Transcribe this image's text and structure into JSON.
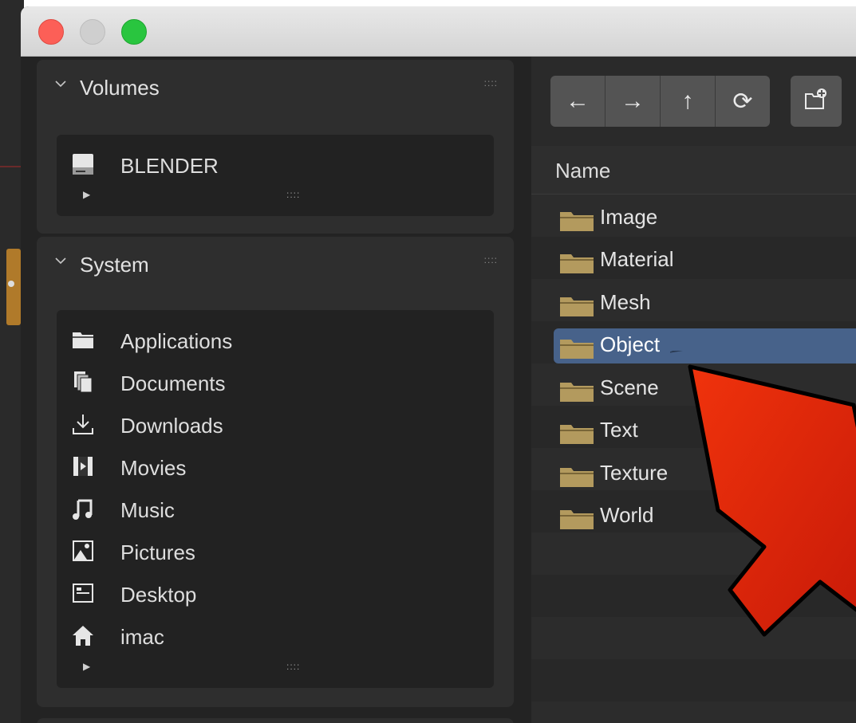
{
  "sidebar": {
    "volumes": {
      "title": "Volumes",
      "items": [
        {
          "label": "BLENDER",
          "icon": "drive-icon"
        }
      ]
    },
    "system": {
      "title": "System",
      "items": [
        {
          "label": "Applications",
          "icon": "folder-icon"
        },
        {
          "label": "Documents",
          "icon": "documents-icon"
        },
        {
          "label": "Downloads",
          "icon": "download-icon"
        },
        {
          "label": "Movies",
          "icon": "film-icon"
        },
        {
          "label": "Music",
          "icon": "music-note-icon"
        },
        {
          "label": "Pictures",
          "icon": "picture-icon"
        },
        {
          "label": "Desktop",
          "icon": "desktop-icon"
        },
        {
          "label": "imac",
          "icon": "home-icon"
        }
      ]
    }
  },
  "toolbar": {
    "buttons": [
      {
        "glyph": "←",
        "icon": "back-arrow-icon"
      },
      {
        "glyph": "→",
        "icon": "forward-arrow-icon"
      },
      {
        "glyph": "↑",
        "icon": "parent-directory-icon"
      },
      {
        "glyph": "⟳",
        "icon": "refresh-icon"
      }
    ],
    "new_folder_icon": "new-folder-icon"
  },
  "filelist": {
    "column_name": "Name",
    "items": [
      "Image",
      "Material",
      "Mesh",
      "Object",
      "Scene",
      "Text",
      "Texture",
      "World"
    ],
    "selected": "Object"
  },
  "colors": {
    "selection": "#47628a",
    "folder": "#b39a5e",
    "annotation_arrow": "#e8200a"
  }
}
